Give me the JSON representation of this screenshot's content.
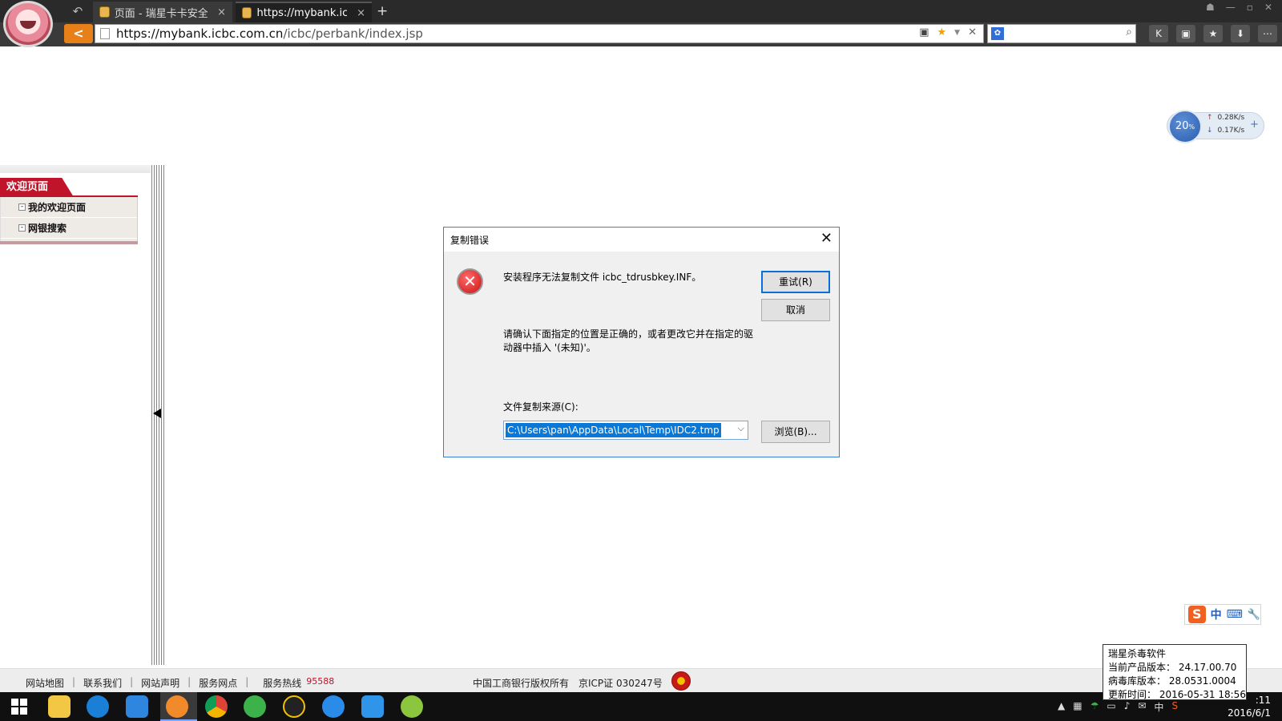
{
  "browser": {
    "tabs": [
      {
        "label": "页面 - 瑞星卡卡安全...",
        "close": "×"
      },
      {
        "label": "https://mybank.icbc",
        "close": "×"
      }
    ],
    "new_tab": "+",
    "url_host": "https://mybank.icbc.com.cn",
    "url_path": "/icbc/perbank/index.jsp"
  },
  "sidebar": {
    "header": "欢迎页面",
    "items": [
      {
        "label": "我的欢迎页面"
      },
      {
        "label": "网银搜索"
      }
    ]
  },
  "speed_widget": {
    "percent": "20",
    "unit": "%",
    "upload": "0.28K/s",
    "download": "0.17K/s",
    "expand": "+"
  },
  "dialog": {
    "title": "复制错误",
    "message": "安装程序无法复制文件 icbc_tdrusbkey.INF。",
    "instruction": "请确认下面指定的位置是正确的，或者更改它并在指定的驱动器中插入 '(未知)'。",
    "source_label": "文件复制来源(C):",
    "source_value": "C:\\Users\\pan\\AppData\\Local\\Temp\\IDC2.tmp",
    "retry_label": "重试(R)",
    "cancel_label": "取消",
    "browse_label": "浏览(B)..."
  },
  "footer": {
    "links": [
      "网站地图",
      "联系我们",
      "网站声明",
      "服务网点"
    ],
    "hotline_label": "服务热线",
    "hotline_number": "95588",
    "copyright": "中国工商银行版权所有",
    "icp": "京ICP证  030247号"
  },
  "ime": {
    "brand": "S",
    "mode": "中"
  },
  "av_tooltip": {
    "lines": [
      "瑞星杀毒软件",
      "当前产品版本： 24.17.00.70",
      "病毒库版本： 28.0531.0004",
      "更新时间： 2016-05-31 18:56"
    ]
  },
  "taskbar": {
    "tray_lang": "中",
    "time": ":11",
    "date": "2016/6/1"
  },
  "colors": {
    "bank_red": "#c0142a",
    "dialog_border": "#3b7fd1",
    "selection_blue": "#0a78d7",
    "nav_back_orange": "#e8801a"
  }
}
